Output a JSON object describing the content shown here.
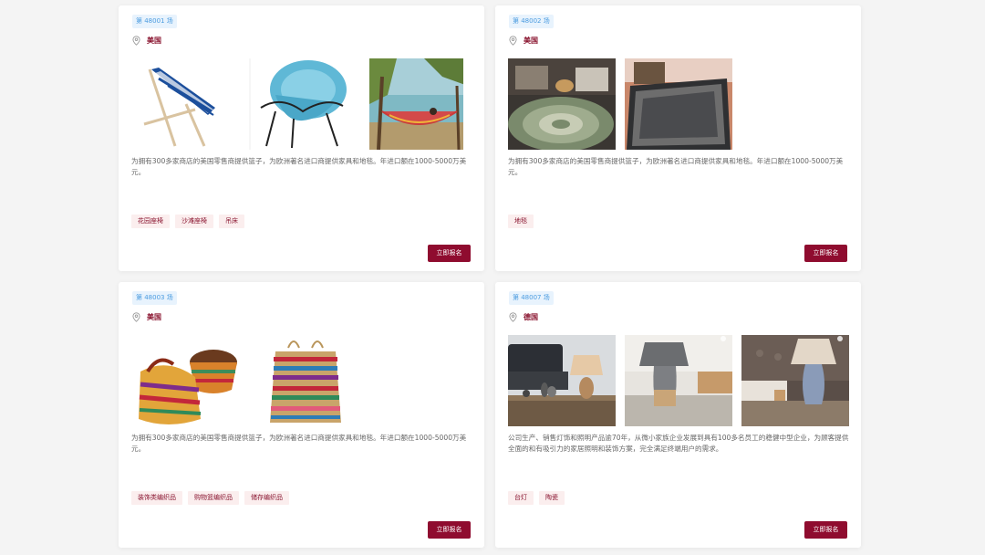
{
  "cards": [
    {
      "session": "第 48001 场",
      "location": "美国",
      "images": [
        "deck-chair-photo",
        "rope-chair-photo",
        "hammock-photo"
      ],
      "description": "为拥有300多家商店的美国零售商提供篮子，为欧洲著名进口商提供家具和地毯。年进口额在1000-5000万美元。",
      "tags": [
        "花园座椅",
        "沙滩座椅",
        "吊床"
      ],
      "signup_label": "立即报名"
    },
    {
      "session": "第 48002 场",
      "location": "美国",
      "images": [
        "round-rug-photo",
        "rectangle-rug-photo"
      ],
      "description": "为拥有300多家商店的美国零售商提供篮子，为欧洲著名进口商提供家具和地毯。年进口额在1000-5000万美元。",
      "tags": [
        "地毯"
      ],
      "signup_label": "立即报名"
    },
    {
      "session": "第 48003 场",
      "location": "美国",
      "images": [
        "woven-basket-photo",
        "stacked-basket-photo"
      ],
      "description": "为拥有300多家商店的美国零售商提供篮子，为欧洲著名进口商提供家具和地毯。年进口额在1000-5000万美元。",
      "tags": [
        "装饰类编织品",
        "购物篮编织品",
        "储存编织品"
      ],
      "signup_label": "立即报名"
    },
    {
      "session": "第 48007 场",
      "location": "德国",
      "images": [
        "lamp-living-room-photo",
        "lamp-grey-photo",
        "lamp-bedroom-photo"
      ],
      "description": "公司生产、销售灯饰和照明产品逾70年，从微小家族企业发展到具有100多名员工的稳健中型企业，为顾客提供全面的和有吸引力的家居照明和装饰方案，完全满足终端用户的需求。",
      "tags": [
        "台灯",
        "陶瓷"
      ],
      "signup_label": "立即报名"
    }
  ],
  "colors": {
    "accent": "#8f0c2f",
    "session_text": "#4a9be0",
    "tag_bg": "#fbeeee"
  }
}
